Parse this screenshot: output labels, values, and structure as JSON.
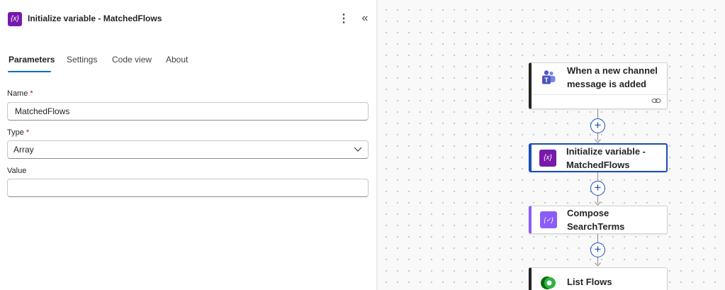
{
  "panel": {
    "title": "Initialize variable - MatchedFlows",
    "icon_label": "{x}",
    "more_glyph": "⋮",
    "collapse_glyph": "«",
    "tabs": [
      {
        "label": "Parameters"
      },
      {
        "label": "Settings"
      },
      {
        "label": "Code view"
      },
      {
        "label": "About"
      }
    ],
    "active_tab": "Parameters",
    "fields": {
      "name": {
        "label": "Name",
        "required_mark": "*",
        "value": "MatchedFlows"
      },
      "type": {
        "label": "Type",
        "required_mark": "*",
        "value": "Array"
      },
      "value": {
        "label": "Value",
        "value": ""
      }
    }
  },
  "canvas": {
    "nodes": [
      {
        "title_line1": "When a new channel",
        "title_line2": "message is added",
        "icon": "teams-icon"
      },
      {
        "title_line1": "Initialize variable -",
        "title_line2": "MatchedFlows",
        "icon_label": "{x}",
        "selected": true
      },
      {
        "title_line1": "Compose",
        "title_line2": "SearchTerms",
        "icon_label": "{✓}"
      },
      {
        "title_line1": "List Flows",
        "icon": "dataverse-icon"
      }
    ],
    "add_glyph": "+"
  },
  "colors": {
    "accent": "#1a4db8",
    "tab_underline": "#0f6cbd",
    "variable_icon": "#7719aa",
    "compose_icon": "#8b5cf6",
    "required": "#c50f1f"
  }
}
